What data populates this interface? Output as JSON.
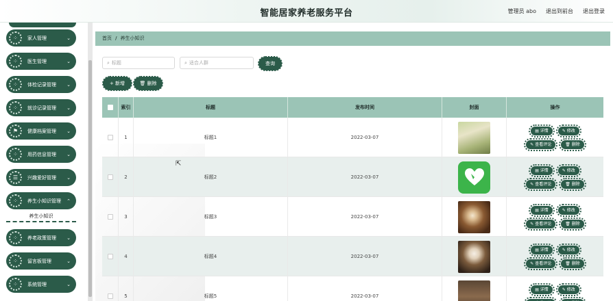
{
  "header": {
    "title": "智能居家养老服务平台",
    "admin": "管理员 abo",
    "back_to_front": "退出到前台",
    "logout": "退出登录"
  },
  "sidebar": {
    "items": [
      {
        "label": "家人管理",
        "icon": "gear-icon"
      },
      {
        "label": "医生管理",
        "icon": "gear-icon"
      },
      {
        "label": "体检记录管理",
        "icon": "gear-icon"
      },
      {
        "label": "就诊记录管理",
        "icon": "gear-icon"
      },
      {
        "label": "健康档案管理",
        "icon": "flag-icon"
      },
      {
        "label": "用药信息管理",
        "icon": "gear-icon"
      },
      {
        "label": "兴趣爱好管理",
        "icon": "list-icon"
      },
      {
        "label": "养生小知识管理",
        "icon": "gear-icon"
      },
      {
        "label": "养老政策管理",
        "icon": "gear-icon"
      },
      {
        "label": "留言板管理",
        "icon": "gear-icon"
      },
      {
        "label": "系统管理",
        "icon": "gear-icon"
      }
    ],
    "sub_item": "养生小知识"
  },
  "breadcrumb": {
    "home": "首页",
    "sep": "/",
    "current": "养生小知识"
  },
  "search": {
    "title_placeholder": "标题",
    "author_placeholder": "适合人群",
    "query_button": "查询"
  },
  "actions": {
    "add": "新增",
    "delete": "删除"
  },
  "table": {
    "columns": [
      "索引",
      "标题",
      "发布时间",
      "封面",
      "操作"
    ],
    "rows": [
      {
        "index": "1",
        "title": "标题1",
        "date": "2022-03-07"
      },
      {
        "index": "2",
        "title": "标题2",
        "date": "2022-03-07"
      },
      {
        "index": "3",
        "title": "标题3",
        "date": "2022-03-07"
      },
      {
        "index": "4",
        "title": "标题4",
        "date": "2022-03-07"
      },
      {
        "index": "5",
        "title": "标题5",
        "date": "2022-03-07"
      }
    ],
    "op_labels": {
      "detail": "详情",
      "edit": "修改",
      "comments": "查看评论",
      "delete": "删除"
    }
  },
  "colors": {
    "primary": "#2b5b49",
    "header_green": "#9bc4b6",
    "alt_row": "#e8efed"
  }
}
